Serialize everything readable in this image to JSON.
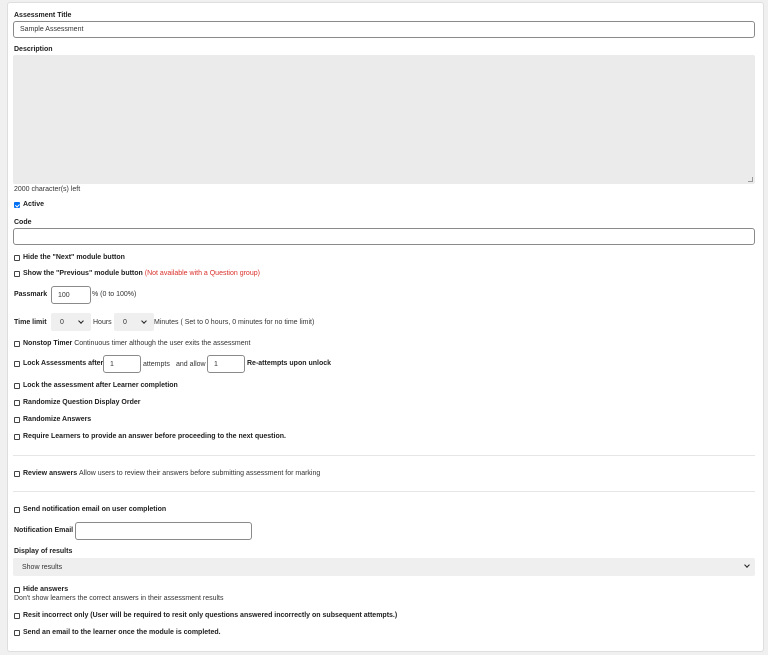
{
  "form": {
    "title_label": "Assessment Title",
    "title_value": "Sample Assessment",
    "description_label": "Description",
    "description_value": "",
    "chars_left": "2000 character(s) left",
    "active_label": "Active",
    "active_checked": true,
    "code_label": "Code",
    "code_value": "",
    "hide_next_label": "Hide the \"Next\" module button",
    "show_previous_label": "Show the \"Previous\" module button",
    "show_previous_note": "(Not available with a Question group)",
    "passmark_label": "Passmark",
    "passmark_value": "100",
    "passmark_hint": "% (0 to 100%)",
    "time_limit_label": "Time limit",
    "hours_value": "0",
    "hours_label": "Hours",
    "minutes_value": "0",
    "minutes_hint": "Minutes ( Set to 0 hours, 0 minutes for no time limit)",
    "nonstop_label": "Nonstop Timer",
    "nonstop_desc": "Continuous timer although the user exits the assessment",
    "lock_after_label": "Lock Assessments after",
    "lock_attempts_value": "1",
    "attempts_text": "attempts",
    "and_allow_text": "and allow",
    "reattempts_value": "1",
    "reattempts_label": "Re-attempts upon unlock",
    "lock_learner_label": "Lock the assessment after Learner completion",
    "randomize_questions_label": "Randomize Question Display Order",
    "randomize_answers_label": "Randomize Answers",
    "require_answer_label": "Require Learners to provide an answer before proceeding to the next question.",
    "review_label": "Review answers",
    "review_desc": "Allow users to review their answers before submitting assessment for marking",
    "send_notification_label": "Send notification email on user completion",
    "notification_email_label": "Notification Email",
    "notification_email_value": "",
    "display_results_label": "Display of results",
    "display_results_value": "Show results",
    "hide_answers_label": "Hide answers",
    "hide_answers_desc": "Don't show learners the correct answers in their assessment results",
    "resit_label": "Resit incorrect only (User will be required to resit only questions answered incorrectly on subsequent attempts.)",
    "send_learner_email_label": "Send an email to the learner once the module is completed."
  },
  "colors": {
    "accent": "#0070f2",
    "warning_text": "#d9302b",
    "textarea_bg": "#ebebeb",
    "select_bg": "#efefef"
  }
}
